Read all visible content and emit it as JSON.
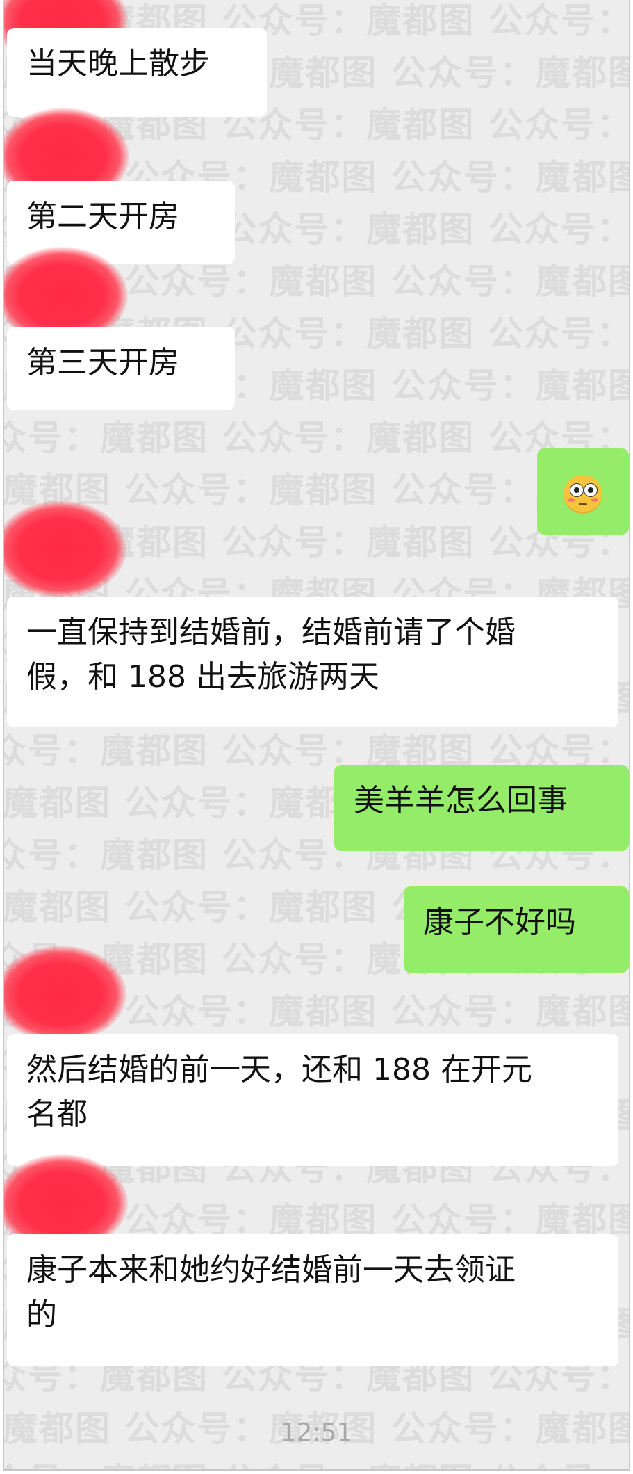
{
  "conversation": {
    "messages": [
      {
        "side": "received",
        "text": "当天晚上散步"
      },
      {
        "side": "received",
        "text": "第二天开房"
      },
      {
        "side": "received",
        "text": "第三天开房"
      },
      {
        "side": "sent",
        "emoji": "flushed-face"
      },
      {
        "side": "received",
        "lines": [
          "一直保持到结婚前，结婚前请了个婚",
          "假，和 188 出去旅游两天"
        ]
      },
      {
        "side": "sent",
        "text": "美羊羊怎么回事"
      },
      {
        "side": "sent",
        "text": "康子不好吗"
      },
      {
        "side": "received",
        "lines": [
          "然后结婚的前一天，还和 188 在开元",
          "名都"
        ]
      },
      {
        "side": "received",
        "lines": [
          "康子本来和她约好结婚前一天去领证",
          "的"
        ]
      }
    ],
    "timestamp": "12:51"
  },
  "watermark": {
    "text": "公众号：魔都图"
  },
  "colors": {
    "background": "#ededed",
    "received_bubble": "#ffffff",
    "sent_bubble": "#95ec69",
    "redaction": "#ff2f4a"
  }
}
